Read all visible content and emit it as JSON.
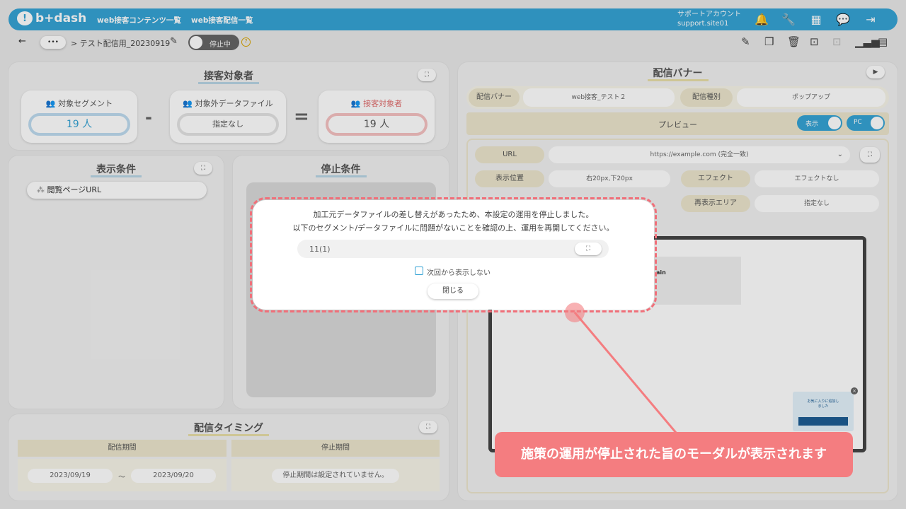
{
  "header": {
    "logo_text": "b+dash",
    "nav": [
      "web接客コンテンツ一覧",
      "web接客配信一覧"
    ],
    "account_name": "サポートアカウント",
    "account_id": "support.site01",
    "icons": [
      "bell-icon",
      "wrench-icon",
      "grid-icon",
      "chat-icon",
      "logout-icon"
    ]
  },
  "subbar": {
    "back": "←",
    "more": "•••",
    "breadcrumb": "> テスト配信用_20230919",
    "toggle_label": "停止中",
    "help": "?",
    "tool_icons": [
      "edit-icon",
      "copy-icon",
      "trash-icon",
      "archive-icon",
      "archive-disabled-icon",
      "chart-icon",
      "document-icon"
    ]
  },
  "target": {
    "title": "接客対象者",
    "segment_label": "対象セグメント",
    "segment_value": "19 人",
    "minus": "-",
    "exclude_label": "対象外データファイル",
    "exclude_value": "指定なし",
    "equals": "=",
    "result_label": "接客対象者",
    "result_value": "19 人"
  },
  "conditions": {
    "display_title": "表示条件",
    "display_item": "閲覧ページURL",
    "stop_title": "停止条件"
  },
  "timing": {
    "title": "配信タイミング",
    "period_label": "配信期間",
    "stop_label": "停止期間",
    "start": "2023/09/19",
    "tilde": "～",
    "end": "2023/09/20",
    "stop_value": "停止期間は設定されていません。"
  },
  "banner": {
    "title": "配信バナー",
    "banner_label": "配信バナー",
    "banner_value": "web接客_テスト２",
    "type_label": "配信種別",
    "type_value": "ポップアップ",
    "preview_label": "プレビュー",
    "show_toggle": "表示",
    "pc_toggle": "PC",
    "url_label": "URL",
    "url_value": "https://example.com (完全一致)",
    "position_label": "表示位置",
    "position_value": "右20px,下20px",
    "effect_label": "エフェクト",
    "effect_value": "エフェクトなし",
    "reshow_label": "再表示エリア",
    "reshow_value": "指定なし",
    "popup_text": "お気に入りに追加しました",
    "preview_heading": "ain"
  },
  "modal": {
    "line1": "加工元データファイルの差し替えがあったため、本設定の運用を停止しました。",
    "line2": "以下のセグメント/データファイルに問題がないことを確認の上、運用を再開してください。",
    "segment_item": "11(1)",
    "checkbox_label": "次回から表示しない",
    "close_button": "閉じる"
  },
  "callout": {
    "text": "施策の運用が停止された旨のモーダルが表示されます"
  },
  "colors": {
    "brand": "#35a3d5",
    "callout": "#f47d80",
    "danger": "#e06b6b"
  }
}
